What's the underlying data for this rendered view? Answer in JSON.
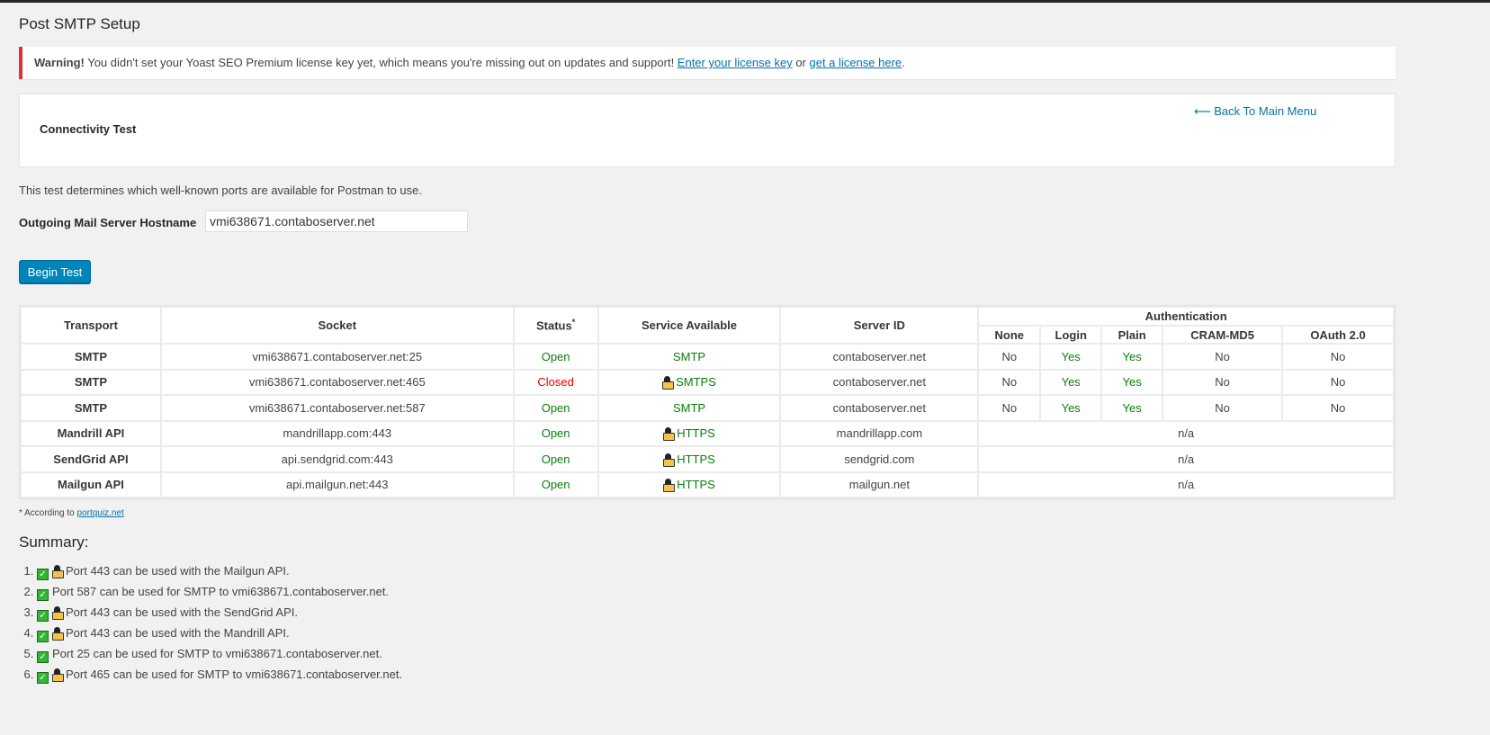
{
  "page": {
    "title": "Post SMTP Setup"
  },
  "notice": {
    "strong": "Warning!",
    "text": " You didn't set your Yoast SEO Premium license key yet, which means you're missing out on updates and support! ",
    "link1": "Enter your license key",
    "mid": " or ",
    "link2": "get a license here",
    "end": "."
  },
  "card": {
    "heading": "Connectivity Test",
    "back": "⟵ Back To Main Menu"
  },
  "description": "This test determines which well-known ports are available for Postman to use.",
  "host": {
    "label": "Outgoing Mail Server Hostname",
    "value": "vmi638671.contaboserver.net"
  },
  "begin_button": "Begin Test",
  "table": {
    "headers": {
      "transport": "Transport",
      "socket": "Socket",
      "status": "Status",
      "status_mark": "*",
      "service": "Service Available",
      "server": "Server ID",
      "auth": "Authentication",
      "auth_cols": [
        "None",
        "Login",
        "Plain",
        "CRAM-MD5",
        "OAuth 2.0"
      ]
    },
    "rows": [
      {
        "transport": "SMTP",
        "socket": "vmi638671.contaboserver.net:25",
        "status": "Open",
        "status_ok": true,
        "service": "SMTP",
        "secure": false,
        "server": "contaboserver.net",
        "auth": [
          "No",
          "Yes",
          "Yes",
          "No",
          "No"
        ]
      },
      {
        "transport": "SMTP",
        "socket": "vmi638671.contaboserver.net:465",
        "status": "Closed",
        "status_ok": false,
        "service": "SMTPS",
        "secure": true,
        "server": "contaboserver.net",
        "auth": [
          "No",
          "Yes",
          "Yes",
          "No",
          "No"
        ]
      },
      {
        "transport": "SMTP",
        "socket": "vmi638671.contaboserver.net:587",
        "status": "Open",
        "status_ok": true,
        "service": "SMTP",
        "secure": false,
        "server": "contaboserver.net",
        "auth": [
          "No",
          "Yes",
          "Yes",
          "No",
          "No"
        ]
      },
      {
        "transport": "Mandrill API",
        "socket": "mandrillapp.com:443",
        "status": "Open",
        "status_ok": true,
        "service": "HTTPS",
        "secure": true,
        "server": "mandrillapp.com",
        "auth_na": "n/a"
      },
      {
        "transport": "SendGrid API",
        "socket": "api.sendgrid.com:443",
        "status": "Open",
        "status_ok": true,
        "service": "HTTPS",
        "secure": true,
        "server": "sendgrid.com",
        "auth_na": "n/a"
      },
      {
        "transport": "Mailgun API",
        "socket": "api.mailgun.net:443",
        "status": "Open",
        "status_ok": true,
        "service": "HTTPS",
        "secure": true,
        "server": "mailgun.net",
        "auth_na": "n/a"
      }
    ]
  },
  "footnote": {
    "text": "* According to ",
    "link": "portquiz.net"
  },
  "summary": {
    "title": "Summary:",
    "items": [
      {
        "text": "Port 443 can be used with the Mailgun API.",
        "secure": true
      },
      {
        "text": "Port 587 can be used for SMTP to vmi638671.contaboserver.net.",
        "secure": false
      },
      {
        "text": "Port 443 can be used with the SendGrid API.",
        "secure": true
      },
      {
        "text": "Port 443 can be used with the Mandrill API.",
        "secure": true
      },
      {
        "text": "Port 25 can be used for SMTP to vmi638671.contaboserver.net.",
        "secure": false
      },
      {
        "text": "Port 465 can be used for SMTP to vmi638671.contaboserver.net.",
        "secure": true
      }
    ]
  }
}
